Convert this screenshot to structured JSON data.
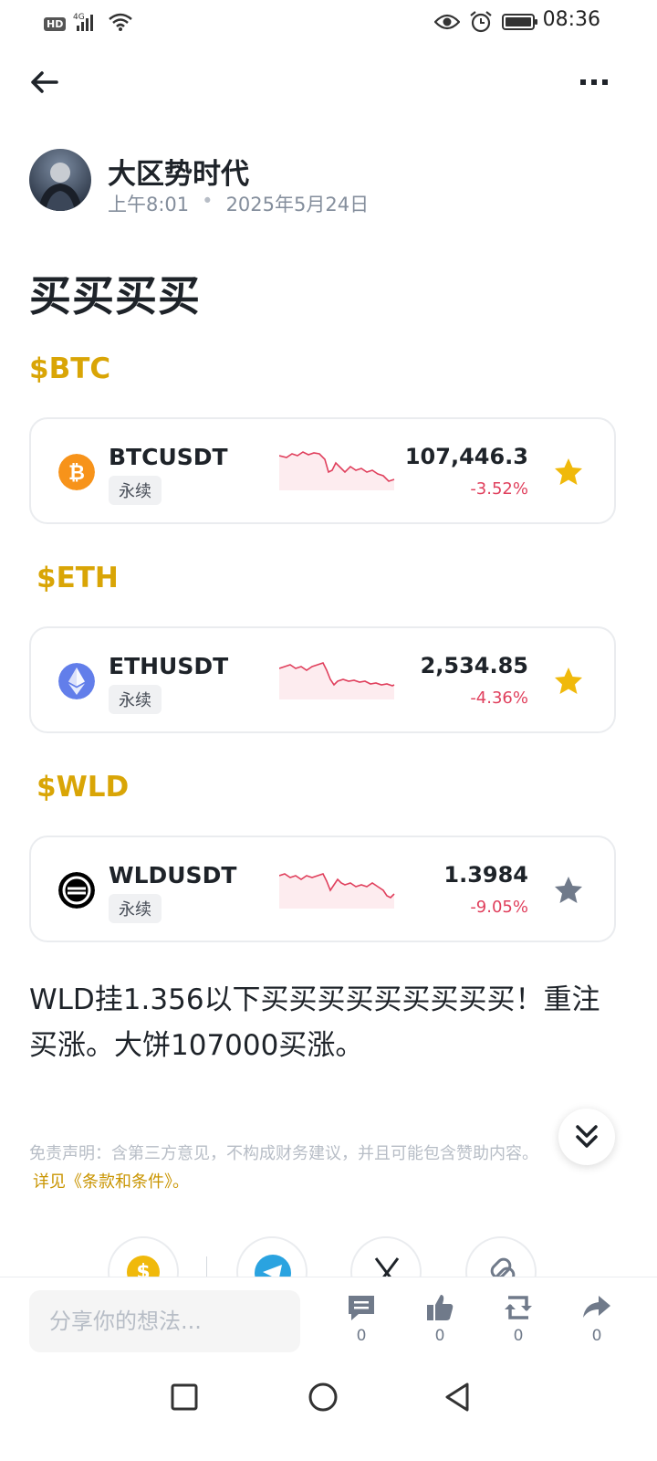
{
  "status_bar": {
    "hd": "HD",
    "network": "4G",
    "time": "08:36"
  },
  "author": {
    "name": "大区势时代",
    "time": "上午8:01",
    "date": "2025年5月24日"
  },
  "post": {
    "title": "买买买买",
    "body": " WLD挂1.356以下买买买买买买买买买！重注买涨。大饼107000买涨。"
  },
  "cards": [
    {
      "tag": "$BTC",
      "symbol": "BTCUSDT",
      "label": "永续",
      "price": "107,446.3",
      "change": "-3.52%",
      "favorited": true,
      "icon": "bitcoin-icon",
      "icon_color": "#f7931a"
    },
    {
      "tag": "$ETH",
      "symbol": "ETHUSDT",
      "label": "永续",
      "price": "2,534.85",
      "change": "-4.36%",
      "favorited": true,
      "icon": "ethereum-icon",
      "icon_color": "#627eea"
    },
    {
      "tag": "$WLD",
      "symbol": "WLDUSDT",
      "label": "永续",
      "price": "1.3984",
      "change": "-9.05%",
      "favorited": false,
      "icon": "worldcoin-icon",
      "icon_color": "#000000"
    }
  ],
  "disclaimer": {
    "text": "免责声明：含第三方意见，不构成财务建议，并且可能包含赞助内容。",
    "link": "详见《条款和条件》。"
  },
  "bottom_bar": {
    "comment_placeholder": "分享你的想法...",
    "comments": "0",
    "likes": "0",
    "reposts": "0",
    "shares": "0"
  },
  "colors": {
    "accent": "#d9a506",
    "negative": "#e0405d",
    "star_active": "#f0b90b",
    "star_inactive": "#707a8a"
  }
}
